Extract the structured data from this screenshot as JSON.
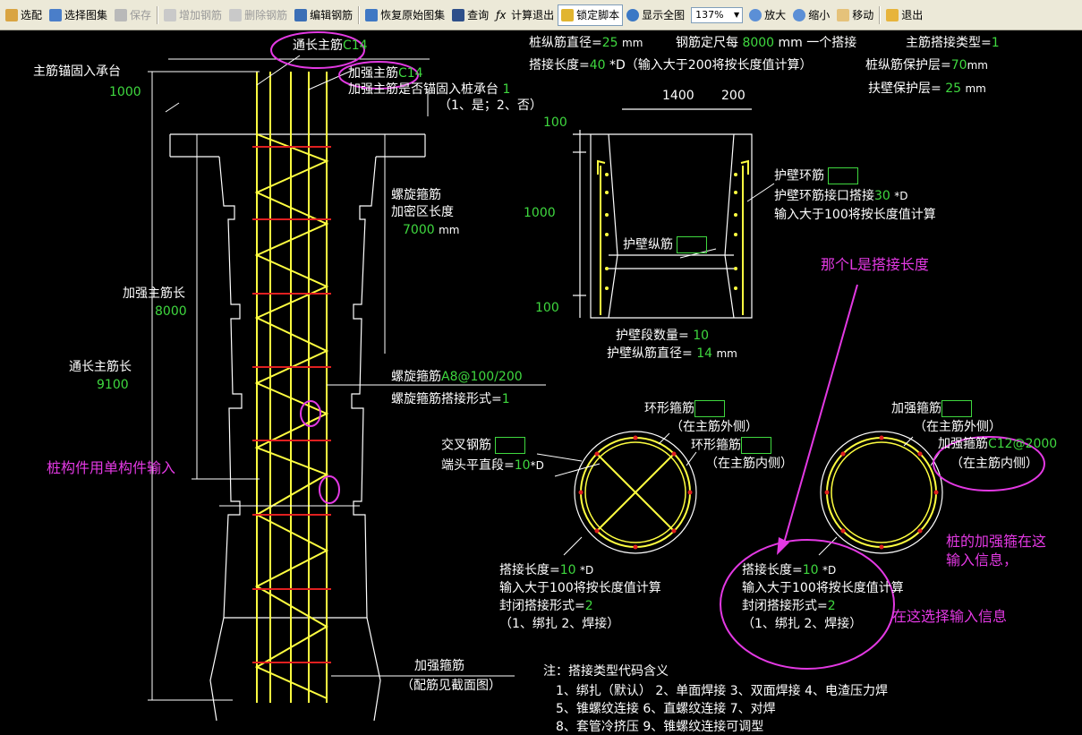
{
  "toolbar": {
    "items": [
      {
        "label": "选配",
        "enabled": true,
        "icon": "select-icon"
      },
      {
        "label": "选择图集",
        "enabled": true,
        "icon": "atlas-icon"
      },
      {
        "label": "保存",
        "enabled": false,
        "icon": "save-icon"
      },
      {
        "label": "增加钢筋",
        "enabled": false,
        "icon": "add-rebar-icon"
      },
      {
        "label": "删除钢筋",
        "enabled": false,
        "icon": "delete-rebar-icon"
      },
      {
        "label": "编辑钢筋",
        "enabled": true,
        "icon": "edit-rebar-icon"
      },
      {
        "label": "恢复原始图集",
        "enabled": true,
        "icon": "restore-icon"
      },
      {
        "label": "查询",
        "enabled": true,
        "icon": "binoculars-icon"
      },
      {
        "label": "计算退出",
        "enabled": true,
        "icon": "fx-icon"
      },
      {
        "label": "锁定脚本",
        "enabled": true,
        "active": true,
        "icon": "lock-icon"
      },
      {
        "label": "显示全图",
        "enabled": true,
        "icon": "fullview-icon"
      }
    ],
    "zoom_value": "137%",
    "items2": [
      {
        "label": "放大",
        "icon": "zoom-in-icon"
      },
      {
        "label": "缩小",
        "icon": "zoom-out-icon"
      },
      {
        "label": "移动",
        "icon": "hand-icon"
      },
      {
        "label": "退出",
        "icon": "exit-icon"
      }
    ]
  },
  "colors": {
    "background": "#000000",
    "line": "#ffffff",
    "value": "#3fd83f",
    "rebar_yellow": "#ffff40",
    "rebar_red": "#e02020",
    "annotation": "#e339e3"
  },
  "params": {
    "pile_main_diameter_label": "桩纵筋直径=",
    "pile_main_diameter_value": "25",
    "unit_mm": "mm",
    "rebar_length_label": "钢筋定尺每",
    "rebar_length_value": "8000",
    "rebar_length_suffix": "mm 一个搭接",
    "main_splice_type_label": "主筋搭接类型=",
    "main_splice_type_value": "1",
    "splice_len_label": "搭接长度=",
    "splice_len_value": "40",
    "splice_len_suffix": "*D（输入大于200将按长度值计算）",
    "cover_label": "桩纵筋保护层=",
    "cover_value": "70",
    "wall_cover_label": "扶壁保护层=",
    "wall_cover_value": "25"
  },
  "left": {
    "through_main": "通长主筋",
    "through_main_val": "C14",
    "reinf_main": "加强主筋",
    "reinf_main_val": "C14",
    "reinf_anchor": "加强主筋是否锚固入桩承台",
    "reinf_anchor_val": "1",
    "reinf_anchor_opts": "（1、是；2、否）",
    "anchor_label": "主筋锚固入承台",
    "anchor_val": "1000",
    "spiral_dense_1": "螺旋箍筋",
    "spiral_dense_2": "加密区长度",
    "spiral_dense_val": "7000",
    "reinf_len_label": "加强主筋长",
    "reinf_len_val": "8000",
    "through_len_label": "通长主筋长",
    "through_len_val": "9100",
    "spiral_label": "螺旋箍筋",
    "spiral_val": "A8@100/200",
    "spiral_splice_label": "螺旋箍筋搭接形式=",
    "spiral_splice_val": "1",
    "reinf_hoop_1": "加强箍筋",
    "reinf_hoop_2": "（配筋见截面图）",
    "note_pile": "桩构件用单构件输入"
  },
  "wall": {
    "dim_1400": "1400",
    "dim_200": "200",
    "dim_100_top": "100",
    "dim_1000": "1000",
    "dim_100_bot": "100",
    "ring_label": "护壁环筋",
    "ring_splice_label": "护壁环筋接口搭接",
    "ring_splice_val": "30",
    "ring_splice_suffix": "*D",
    "ring_note": "输入大于100将按长度值计算",
    "long_label": "护壁纵筋",
    "seg_count_label": "护壁段数量=",
    "seg_count_val": "10",
    "long_dia_label": "护壁纵筋直径=",
    "long_dia_val": "14"
  },
  "section1": {
    "ring_outer": "环形箍筋",
    "ring_outer_note": "（在主筋外侧）",
    "ring_inner": "环形箍筋",
    "ring_inner_note": "（在主筋内侧）",
    "cross_label": "交叉钢筋",
    "end_label": "端头平直段=",
    "end_val": "10",
    "end_suffix": "*D",
    "splice_label": "搭接长度=",
    "splice_val": "10",
    "splice_suffix": "*D",
    "note1": "输入大于100将按长度值计算",
    "closed_label": "封闭搭接形式=",
    "closed_val": "2",
    "closed_opts": "（1、绑扎  2、焊接）"
  },
  "section2": {
    "reinf_outer": "加强箍筋",
    "reinf_outer_note": "（在主筋外侧）",
    "reinf_inner": "加强箍筋",
    "reinf_inner_val": "C12@2000",
    "reinf_inner_note": "（在主筋内侧）",
    "splice_label": "搭接长度=",
    "splice_val": "10",
    "splice_suffix": "*D",
    "note1": "输入大于100将按长度值计算",
    "closed_label": "封闭搭接形式=",
    "closed_val": "2",
    "closed_opts": "（1、绑扎  2、焊接）"
  },
  "notes": {
    "title": "注：搭接类型代码含义",
    "row1": "1、绑扎（默认）    2、单面焊接    3、双面焊接    4、电渣压力焊",
    "row2": "5、锥螺纹连接    6、直螺纹连接    7、对焊",
    "row3": "8、套管冷挤压    9、锥螺纹连接可调型"
  },
  "annotations": {
    "l_is_splice": "那个L是搭接长度",
    "hoop_info_1": "桩的加强箍在这",
    "hoop_info_2": "输入信息，",
    "select_here": "在这选择输入信息"
  }
}
